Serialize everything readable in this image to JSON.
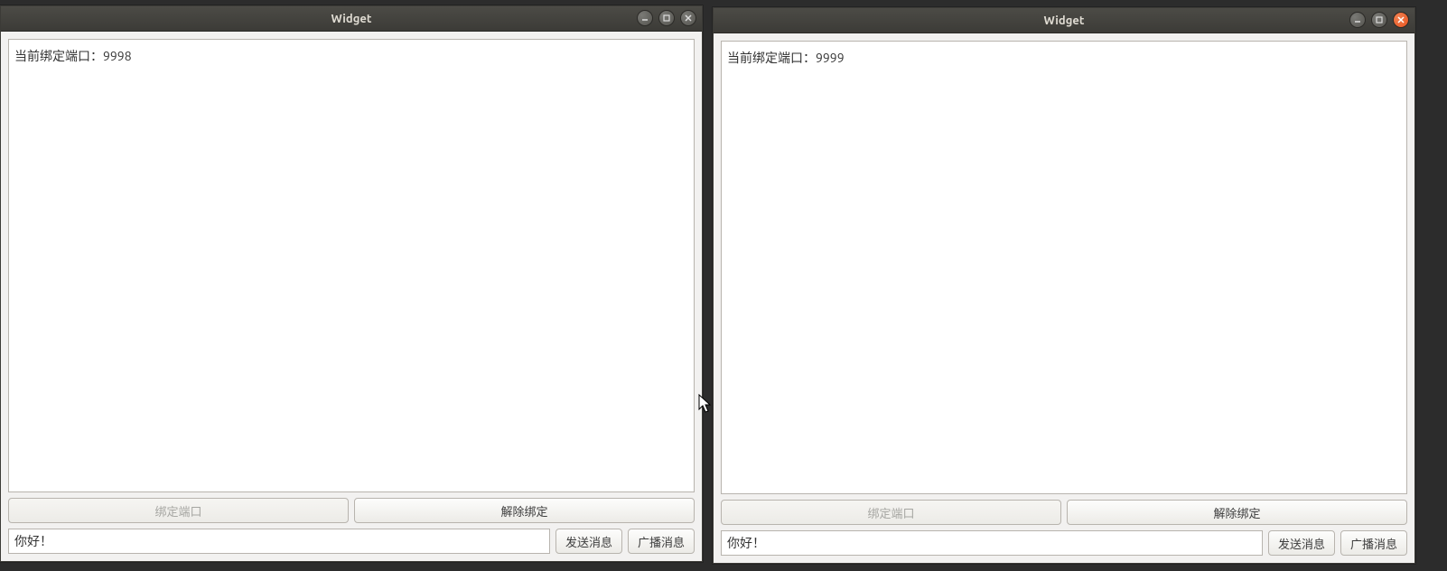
{
  "windows": [
    {
      "title": "Widget",
      "port_label": "当前绑定端口：",
      "port_value": "9998",
      "bind_button": "绑定端口",
      "unbind_button": "解除绑定",
      "message_value": "你好！",
      "send_button": "发送消息",
      "broadcast_button": "广播消息",
      "close_active": false,
      "controls_side": "right"
    },
    {
      "title": "Widget",
      "port_label": "当前绑定端口：",
      "port_value": "9999",
      "bind_button": "绑定端口",
      "unbind_button": "解除绑定",
      "message_value": "你好！",
      "send_button": "发送消息",
      "broadcast_button": "广播消息",
      "close_active": true,
      "controls_side": "right"
    }
  ]
}
